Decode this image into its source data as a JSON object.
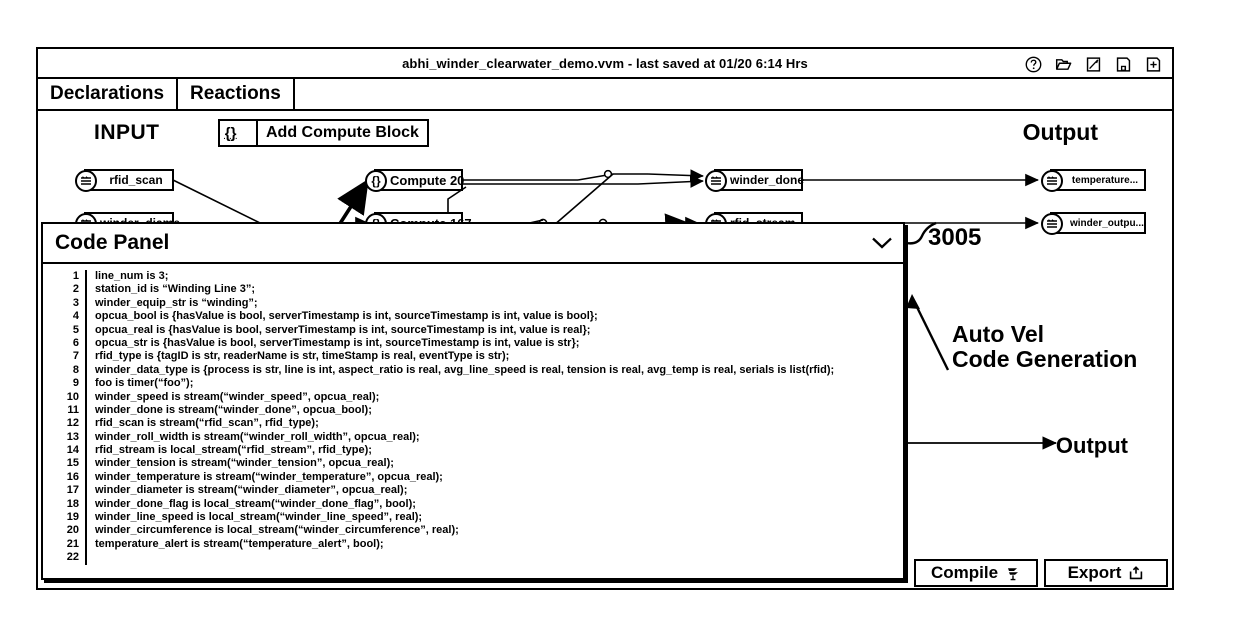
{
  "window": {
    "title": "abhi_winder_clearwater_demo.vvm - last saved at 01/20 6:14 Hrs",
    "icons": [
      {
        "name": "help-icon",
        "label": "?"
      },
      {
        "name": "open-folder-icon",
        "label": "open"
      },
      {
        "name": "edit-icon",
        "label": "edit"
      },
      {
        "name": "save-icon",
        "label": "save"
      },
      {
        "name": "new-file-icon",
        "label": "new"
      }
    ]
  },
  "tabs": [
    {
      "id": "declarations",
      "label": "Declarations"
    },
    {
      "id": "reactions",
      "label": "Reactions"
    }
  ],
  "graph": {
    "input_label": "INPUT",
    "output_label": "Output",
    "output_label_mid": "Output",
    "add_compute_block": {
      "icon": "{}",
      "icon_dots": ".....",
      "label": "Add Compute Block"
    },
    "input_nodes": [
      {
        "name": "rfid-scan-node",
        "label": "rfid_scan"
      },
      {
        "name": "winder-diameter-node",
        "label": "winder_diame..."
      }
    ],
    "compute_nodes": [
      {
        "name": "compute-20-node",
        "icon": "{}",
        "label": "Compute 20"
      },
      {
        "name": "compute-167-node",
        "icon": "{}",
        "label": "Compute 167"
      }
    ],
    "mid_nodes": [
      {
        "name": "winder-done-node",
        "label": "winder_done"
      },
      {
        "name": "rfid-stream-node",
        "label": "rfid_stream"
      }
    ],
    "output_nodes": [
      {
        "name": "temperature-output-node",
        "label": "temperature..."
      },
      {
        "name": "winder-output-node",
        "label": "winder_outpu..."
      }
    ]
  },
  "code_panel": {
    "title": "Code Panel",
    "collapse_icon": "chevron-down",
    "lines": [
      {
        "n": "1",
        "text": "line_num is 3;"
      },
      {
        "n": "2",
        "text": "station_id is “Winding Line 3”;"
      },
      {
        "n": "3",
        "text": "winder_equip_str is “winding”;"
      },
      {
        "n": "4",
        "text": "opcua_bool is {hasValue is bool, serverTimestamp is int, sourceTimestamp is int, value is bool};"
      },
      {
        "n": "5",
        "text": "opcua_real is {hasValue is bool, serverTimestamp is int, sourceTimestamp is int, value is real};"
      },
      {
        "n": "6",
        "text": "opcua_str is {hasValue is bool, serverTimestamp is int, sourceTimestamp is int, value is str};"
      },
      {
        "n": "7",
        "text": "rfid_type is {tagID is str, readerName is str, timeStamp is real, eventType is str);"
      },
      {
        "n": "8",
        "text": "winder_data_type is {process is str, line is int, aspect_ratio is real, avg_line_speed is real, tension is real, avg_temp is real, serials is list(rfid);"
      },
      {
        "n": "9",
        "text": "foo is timer(“foo”);"
      },
      {
        "n": "10",
        "text": "winder_speed is stream(“winder_speed”, opcua_real);"
      },
      {
        "n": "11",
        "text": "winder_done is stream(“winder_done”, opcua_bool);"
      },
      {
        "n": "12",
        "text": "rfid_scan is stream(“rfid_scan”, rfid_type);"
      },
      {
        "n": "13",
        "text": "winder_roll_width is stream(“winder_roll_width”, opcua_real);"
      },
      {
        "n": "14",
        "text": "rfid_stream is local_stream(“rfid_stream”, rfid_type);"
      },
      {
        "n": "15",
        "text": "winder_tension is stream(“winder_tension”, opcua_real);"
      },
      {
        "n": "16",
        "text": "winder_temperature is stream(“winder_temperature”, opcua_real);"
      },
      {
        "n": "17",
        "text": "winder_diameter is stream(“winder_diameter”, opcua_real);"
      },
      {
        "n": "18",
        "text": "winder_done_flag is local_stream(“winder_done_flag”, bool);"
      },
      {
        "n": "19",
        "text": "winder_line_speed is local_stream(“winder_line_speed”, real);"
      },
      {
        "n": "20",
        "text": "winder_circumference is local_stream(“winder_circumference”, real);"
      },
      {
        "n": "21",
        "text": "temperature_alert is stream(“temperature_alert”, bool);"
      },
      {
        "n": "22",
        "text": ""
      }
    ]
  },
  "actions": [
    {
      "name": "compile-button",
      "label": "Compile",
      "icon": "gear-flow-icon"
    },
    {
      "name": "export-button",
      "label": "Export",
      "icon": "upload-icon"
    }
  ],
  "callouts": {
    "reference_number": "3005",
    "annotation_line1": "Auto Vel",
    "annotation_line2": "Code Generation"
  },
  "colors": {
    "ink": "#000000",
    "paper": "#ffffff"
  }
}
